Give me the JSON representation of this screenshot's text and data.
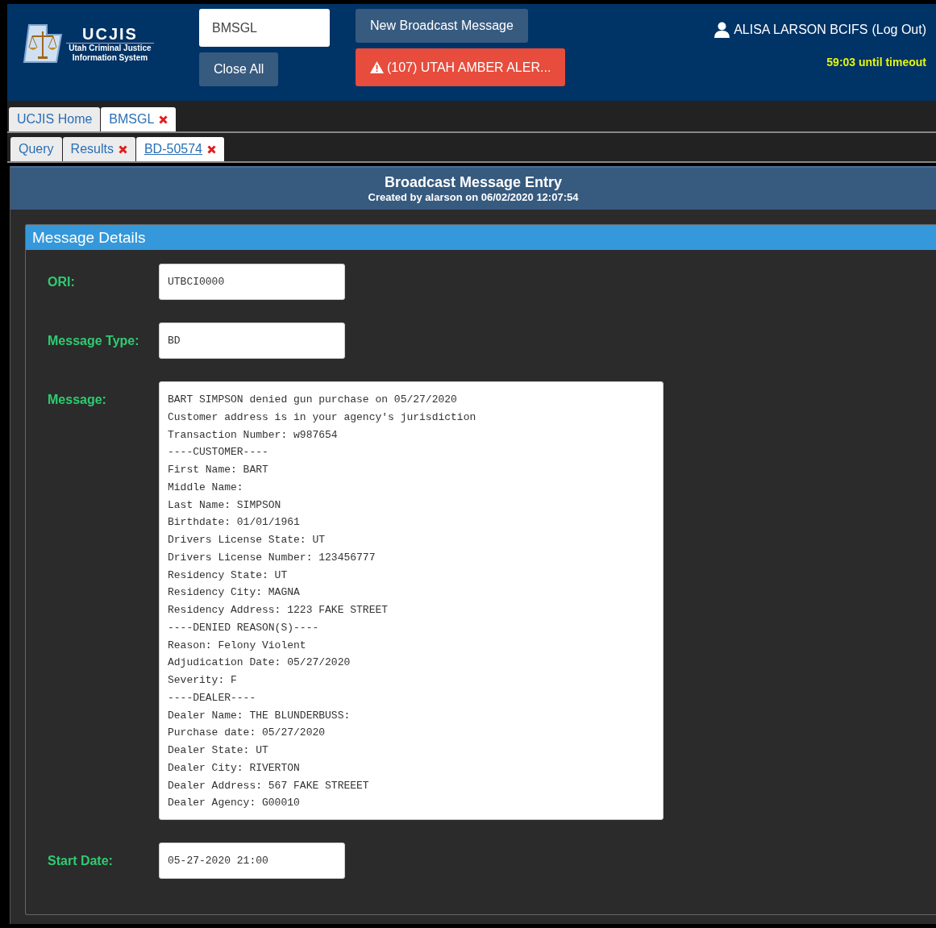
{
  "header": {
    "logo": {
      "title": "UCJIS",
      "subtitle_lines": [
        "Utah Criminal Justice",
        "Information System"
      ]
    },
    "search": {
      "value": "BMSGL"
    },
    "buttons": [
      {
        "label": "Close All",
        "kind": "plain"
      },
      {
        "label": "New Broadcast Message",
        "kind": "plain"
      },
      {
        "label": "(107) UTAH AMBER ALER...",
        "kind": "alert"
      }
    ],
    "user": {
      "name": "ALISA LARSON  BCIFS",
      "logout": "(Log Out)"
    },
    "timeout": "59:03 until timeout"
  },
  "tabs": [
    {
      "label": "UCJIS Home",
      "selected": false,
      "closable": false
    },
    {
      "label": "BMSGL",
      "selected": true,
      "closable": true
    }
  ],
  "subtabs": [
    {
      "label": "Query",
      "selected": false,
      "closable": false
    },
    {
      "label": "Results",
      "selected": false,
      "closable": true
    },
    {
      "label": "BD-50574",
      "selected": true,
      "closable": true
    }
  ],
  "page": {
    "title": "Broadcast Message Entry",
    "subtitle": "Created by alarson on 06/02/2020 12:07:54"
  },
  "panel": {
    "title": "Message Details",
    "fields": [
      {
        "label": "ORI:",
        "value": "UTBCI0000",
        "kind": "input"
      },
      {
        "label": "Message Type:",
        "value": "BD",
        "kind": "input"
      },
      {
        "label": "Message:",
        "value": "BART SIMPSON denied gun purchase on 05/27/2020\nCustomer address is in your agency's jurisdiction\nTransaction Number: w987654\n----CUSTOMER----\nFirst Name: BART\nMiddle Name:\nLast Name: SIMPSON\nBirthdate: 01/01/1961\nDrivers License State: UT\nDrivers License Number: 123456777\nResidency State: UT\nResidency City: MAGNA\nResidency Address: 1223 FAKE STREET\n----DENIED REASON(S)----\nReason: Felony Violent\nAdjudication Date: 05/27/2020\nSeverity: F\n----DEALER----\nDealer Name: THE BLUNDERBUSS:\nPurchase date: 05/27/2020\nDealer State: UT\nDealer City: RIVERTON\nDealer Address: 567 FAKE STREEET\nDealer Agency: G00010",
        "kind": "textarea"
      },
      {
        "label": "Start Date:",
        "value": "05-27-2020 21:00",
        "kind": "input"
      }
    ]
  }
}
